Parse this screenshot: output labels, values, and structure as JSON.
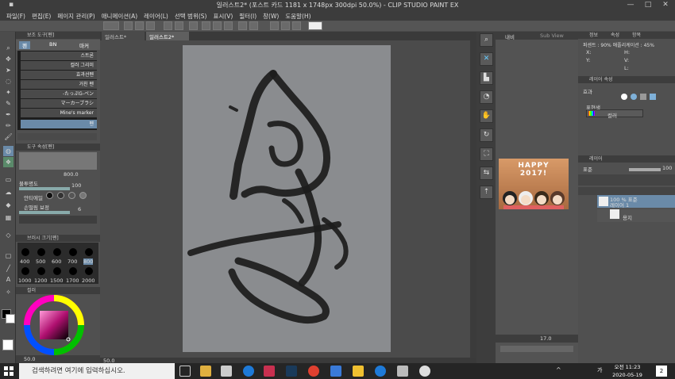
{
  "window": {
    "title": "일러스트2* (포스트 카드 1181 x 1748px 300dpi 50.0%) - CLIP STUDIO PAINT EX",
    "min_icon": "minimize-icon",
    "max_icon": "maximize-icon",
    "close_icon": "close-icon"
  },
  "menu": [
    "파일(F)",
    "편집(E)",
    "페이지 관리(P)",
    "애니메이션(A)",
    "레이어(L)",
    "선택 범위(S)",
    "표시(V)",
    "필터(I)",
    "창(W)",
    "도움말(H)"
  ],
  "tabs": [
    {
      "label": "일러스트*"
    },
    {
      "label": "일러스트2*"
    }
  ],
  "left_panel": {
    "subtool_title": "보조 도구[펜]",
    "subtool_tabs": [
      "펜",
      "BN",
      "마커"
    ],
    "brushes": [
      "스트론",
      "컬러 그리미",
      "효과선펜",
      "거친 펜",
      "-たっぷG-ペン",
      "マーカーブラシ",
      "Mine's marker"
    ],
    "selected_brush_label": "펜",
    "tool_property_title": "도구 속성[펜]",
    "brush_size_value": "800.0",
    "opacity_label": "불투명도",
    "opacity_value": "100",
    "antialias_label": "안티에일",
    "stabilization_label": "손떨림 보정",
    "stabilization_value": "6",
    "brush_size_title": "브러시 크기[펜]",
    "sizes": [
      "400",
      "500",
      "600",
      "700",
      "800",
      "1000",
      "1200",
      "1500",
      "1700",
      "2000"
    ],
    "color_title": "컬러",
    "zoom_value": "50.0"
  },
  "nav_panel": {
    "tab1": "내비",
    "tab2": "Sub View",
    "tab3": "태그",
    "thumb_text": "HAPPY 2017!",
    "rotate_value": "17.0"
  },
  "right_panel": {
    "info_tabs": [
      "정보",
      "속성",
      "항목"
    ],
    "info_line": "퍼센트 : 90% 애플리케이션 : 45%",
    "coords": [
      "X:",
      "Y:",
      "H:",
      "V:",
      "L:"
    ],
    "layer_attr_title": "레이어 속성",
    "effect_label": "효과",
    "display_color_label": "표현색",
    "color_mode": "컬러",
    "layer_title": "레이어",
    "blend_mode": "표준",
    "layer_opacity": "100",
    "layers": [
      {
        "name": "100 % 표준",
        "sub": "레이어 1"
      },
      {
        "name": "용지"
      }
    ]
  },
  "taskbar": {
    "search_placeholder": "검색하려면 여기에 입력하십시오.",
    "time": "오전 11:23",
    "date": "2020-05-19",
    "lang": "가",
    "notif_count": "2"
  },
  "colors": {
    "bg": "#4a4a4a",
    "paper": "#8a8c8f",
    "stroke": "#1c1c1c",
    "accent": "#7eb0d8"
  }
}
